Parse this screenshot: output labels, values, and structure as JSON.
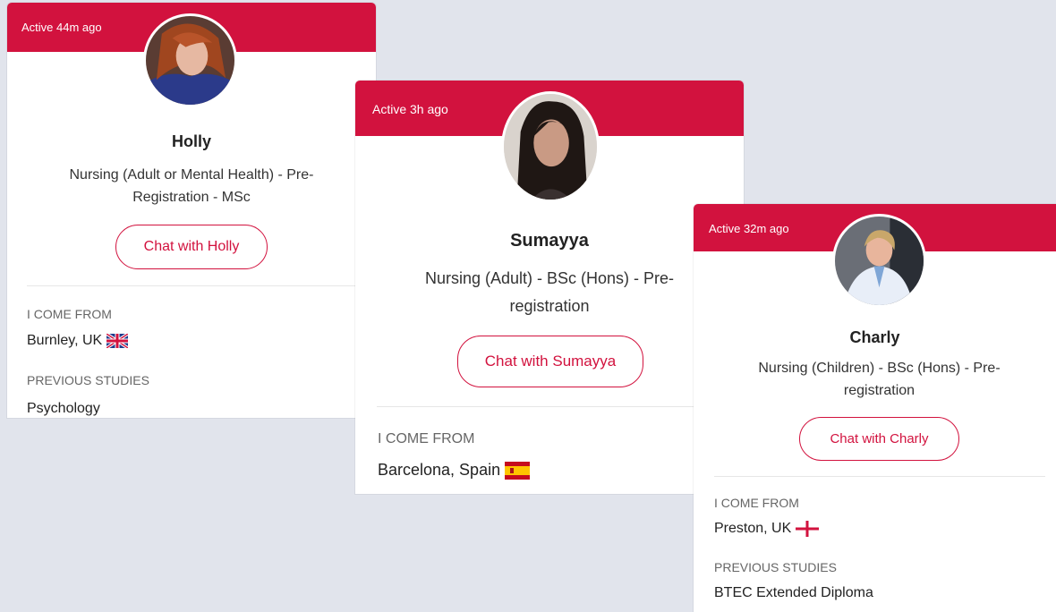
{
  "colors": {
    "accent": "#d2123e",
    "background": "#e1e4ec"
  },
  "cards": [
    {
      "active": "Active 44m ago",
      "name": "Holly",
      "course": "Nursing (Adult or Mental Health) - Pre-Registration - MSc",
      "chat_label": "Chat with Holly",
      "from_label": "I COME FROM",
      "from_value": "Burnley, UK",
      "from_flag": "uk-flag-icon",
      "studies_label": "PREVIOUS STUDIES",
      "studies_value": "Psychology"
    },
    {
      "active": "Active 3h ago",
      "name": "Sumayya",
      "course": "Nursing (Adult) - BSc (Hons) - Pre-registration",
      "chat_label": "Chat with Sumayya",
      "from_label": "I COME FROM",
      "from_value": "Barcelona, Spain",
      "from_flag": "spain-flag-icon"
    },
    {
      "active": "Active 32m ago",
      "name": "Charly",
      "course": "Nursing (Children) - BSc (Hons) - Pre-registration",
      "chat_label": "Chat with Charly",
      "from_label": "I COME FROM",
      "from_value": "Preston, UK",
      "from_flag": "england-flag-icon",
      "studies_label": "PREVIOUS STUDIES",
      "studies_value": "BTEC Extended Diploma"
    }
  ]
}
